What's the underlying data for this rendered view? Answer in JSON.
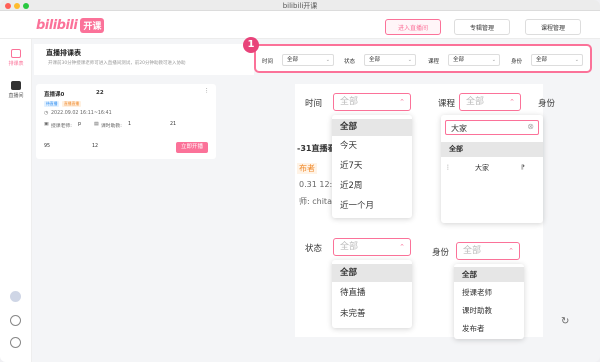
{
  "window": {
    "title": "bilibili开课"
  },
  "brand": {
    "logo_text": "bilibili",
    "logo_tag": "开课"
  },
  "header": {
    "buttons": [
      "进入直播间",
      "专辑管理",
      "课程管理"
    ]
  },
  "sidebar": {
    "items": [
      {
        "label": "排课表",
        "icon": "calendar-icon"
      },
      {
        "label": "直播间",
        "icon": "tv-icon"
      }
    ]
  },
  "panel": {
    "title": "直播排课表",
    "subtitle": "开课前30分钟授课老师可进入直播间测试，前20分钟助教可进入协助"
  },
  "filter_bar": {
    "badge": "1",
    "filters": [
      {
        "label": "时间",
        "value": "全部"
      },
      {
        "label": "状态",
        "value": "全部"
      },
      {
        "label": "课程",
        "value": "全部"
      },
      {
        "label": "身份",
        "value": "全部"
      }
    ]
  },
  "card": {
    "title": "直播课0",
    "title_suffix": "22",
    "tags": [
      "待直播",
      "直播直播"
    ],
    "time": "2022.09.02  16:11~16:41",
    "teacher_label": "授课老师:",
    "teacher_value": "p",
    "assistant_label": "课时助教:",
    "assistant_value": "1",
    "count": "21",
    "num_a": "95",
    "num_b": "12",
    "start_button": "立即开播"
  },
  "time_filter": {
    "label": "时间",
    "placeholder": "全部",
    "options": [
      "全部",
      "今天",
      "近7天",
      "近2周",
      "近一个月"
    ],
    "selected_index": 0
  },
  "course_filter": {
    "label": "课程",
    "placeholder": "全部",
    "search_value": "大家",
    "options": [
      "全部",
      "大家"
    ],
    "selected_index": 0,
    "right_label": "身份"
  },
  "status_filter": {
    "label": "状态",
    "placeholder": "全部",
    "options": [
      "全部",
      "待直播",
      "未完善"
    ],
    "selected_index": 0
  },
  "identity_filter": {
    "label": "身份",
    "placeholder": "全部",
    "options": [
      "全部",
      "授课老师",
      "课时助教",
      "发布者"
    ],
    "selected_index": 0
  },
  "background_fragments": {
    "live_text": "-31直播看",
    "tag_text": "布者",
    "time_text": "0.31 12:00",
    "teacher_text": "师: chita"
  },
  "colors": {
    "accent": "#fb7299",
    "badge": "#e8437a"
  }
}
